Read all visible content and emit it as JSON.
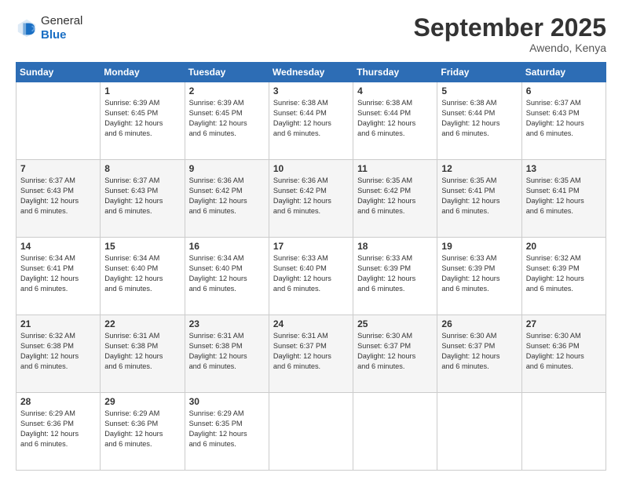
{
  "logo": {
    "line1": "General",
    "line2": "Blue"
  },
  "title": "September 2025",
  "subtitle": "Awendo, Kenya",
  "days": [
    "Sunday",
    "Monday",
    "Tuesday",
    "Wednesday",
    "Thursday",
    "Friday",
    "Saturday"
  ],
  "weeks": [
    [
      {
        "day": "",
        "info": ""
      },
      {
        "day": "1",
        "info": "Sunrise: 6:39 AM\nSunset: 6:45 PM\nDaylight: 12 hours\nand 6 minutes."
      },
      {
        "day": "2",
        "info": "Sunrise: 6:39 AM\nSunset: 6:45 PM\nDaylight: 12 hours\nand 6 minutes."
      },
      {
        "day": "3",
        "info": "Sunrise: 6:38 AM\nSunset: 6:44 PM\nDaylight: 12 hours\nand 6 minutes."
      },
      {
        "day": "4",
        "info": "Sunrise: 6:38 AM\nSunset: 6:44 PM\nDaylight: 12 hours\nand 6 minutes."
      },
      {
        "day": "5",
        "info": "Sunrise: 6:38 AM\nSunset: 6:44 PM\nDaylight: 12 hours\nand 6 minutes."
      },
      {
        "day": "6",
        "info": "Sunrise: 6:37 AM\nSunset: 6:43 PM\nDaylight: 12 hours\nand 6 minutes."
      }
    ],
    [
      {
        "day": "7",
        "info": "Sunrise: 6:37 AM\nSunset: 6:43 PM\nDaylight: 12 hours\nand 6 minutes."
      },
      {
        "day": "8",
        "info": "Sunrise: 6:37 AM\nSunset: 6:43 PM\nDaylight: 12 hours\nand 6 minutes."
      },
      {
        "day": "9",
        "info": "Sunrise: 6:36 AM\nSunset: 6:42 PM\nDaylight: 12 hours\nand 6 minutes."
      },
      {
        "day": "10",
        "info": "Sunrise: 6:36 AM\nSunset: 6:42 PM\nDaylight: 12 hours\nand 6 minutes."
      },
      {
        "day": "11",
        "info": "Sunrise: 6:35 AM\nSunset: 6:42 PM\nDaylight: 12 hours\nand 6 minutes."
      },
      {
        "day": "12",
        "info": "Sunrise: 6:35 AM\nSunset: 6:41 PM\nDaylight: 12 hours\nand 6 minutes."
      },
      {
        "day": "13",
        "info": "Sunrise: 6:35 AM\nSunset: 6:41 PM\nDaylight: 12 hours\nand 6 minutes."
      }
    ],
    [
      {
        "day": "14",
        "info": "Sunrise: 6:34 AM\nSunset: 6:41 PM\nDaylight: 12 hours\nand 6 minutes."
      },
      {
        "day": "15",
        "info": "Sunrise: 6:34 AM\nSunset: 6:40 PM\nDaylight: 12 hours\nand 6 minutes."
      },
      {
        "day": "16",
        "info": "Sunrise: 6:34 AM\nSunset: 6:40 PM\nDaylight: 12 hours\nand 6 minutes."
      },
      {
        "day": "17",
        "info": "Sunrise: 6:33 AM\nSunset: 6:40 PM\nDaylight: 12 hours\nand 6 minutes."
      },
      {
        "day": "18",
        "info": "Sunrise: 6:33 AM\nSunset: 6:39 PM\nDaylight: 12 hours\nand 6 minutes."
      },
      {
        "day": "19",
        "info": "Sunrise: 6:33 AM\nSunset: 6:39 PM\nDaylight: 12 hours\nand 6 minutes."
      },
      {
        "day": "20",
        "info": "Sunrise: 6:32 AM\nSunset: 6:39 PM\nDaylight: 12 hours\nand 6 minutes."
      }
    ],
    [
      {
        "day": "21",
        "info": "Sunrise: 6:32 AM\nSunset: 6:38 PM\nDaylight: 12 hours\nand 6 minutes."
      },
      {
        "day": "22",
        "info": "Sunrise: 6:31 AM\nSunset: 6:38 PM\nDaylight: 12 hours\nand 6 minutes."
      },
      {
        "day": "23",
        "info": "Sunrise: 6:31 AM\nSunset: 6:38 PM\nDaylight: 12 hours\nand 6 minutes."
      },
      {
        "day": "24",
        "info": "Sunrise: 6:31 AM\nSunset: 6:37 PM\nDaylight: 12 hours\nand 6 minutes."
      },
      {
        "day": "25",
        "info": "Sunrise: 6:30 AM\nSunset: 6:37 PM\nDaylight: 12 hours\nand 6 minutes."
      },
      {
        "day": "26",
        "info": "Sunrise: 6:30 AM\nSunset: 6:37 PM\nDaylight: 12 hours\nand 6 minutes."
      },
      {
        "day": "27",
        "info": "Sunrise: 6:30 AM\nSunset: 6:36 PM\nDaylight: 12 hours\nand 6 minutes."
      }
    ],
    [
      {
        "day": "28",
        "info": "Sunrise: 6:29 AM\nSunset: 6:36 PM\nDaylight: 12 hours\nand 6 minutes."
      },
      {
        "day": "29",
        "info": "Sunrise: 6:29 AM\nSunset: 6:36 PM\nDaylight: 12 hours\nand 6 minutes."
      },
      {
        "day": "30",
        "info": "Sunrise: 6:29 AM\nSunset: 6:35 PM\nDaylight: 12 hours\nand 6 minutes."
      },
      {
        "day": "",
        "info": ""
      },
      {
        "day": "",
        "info": ""
      },
      {
        "day": "",
        "info": ""
      },
      {
        "day": "",
        "info": ""
      }
    ]
  ]
}
